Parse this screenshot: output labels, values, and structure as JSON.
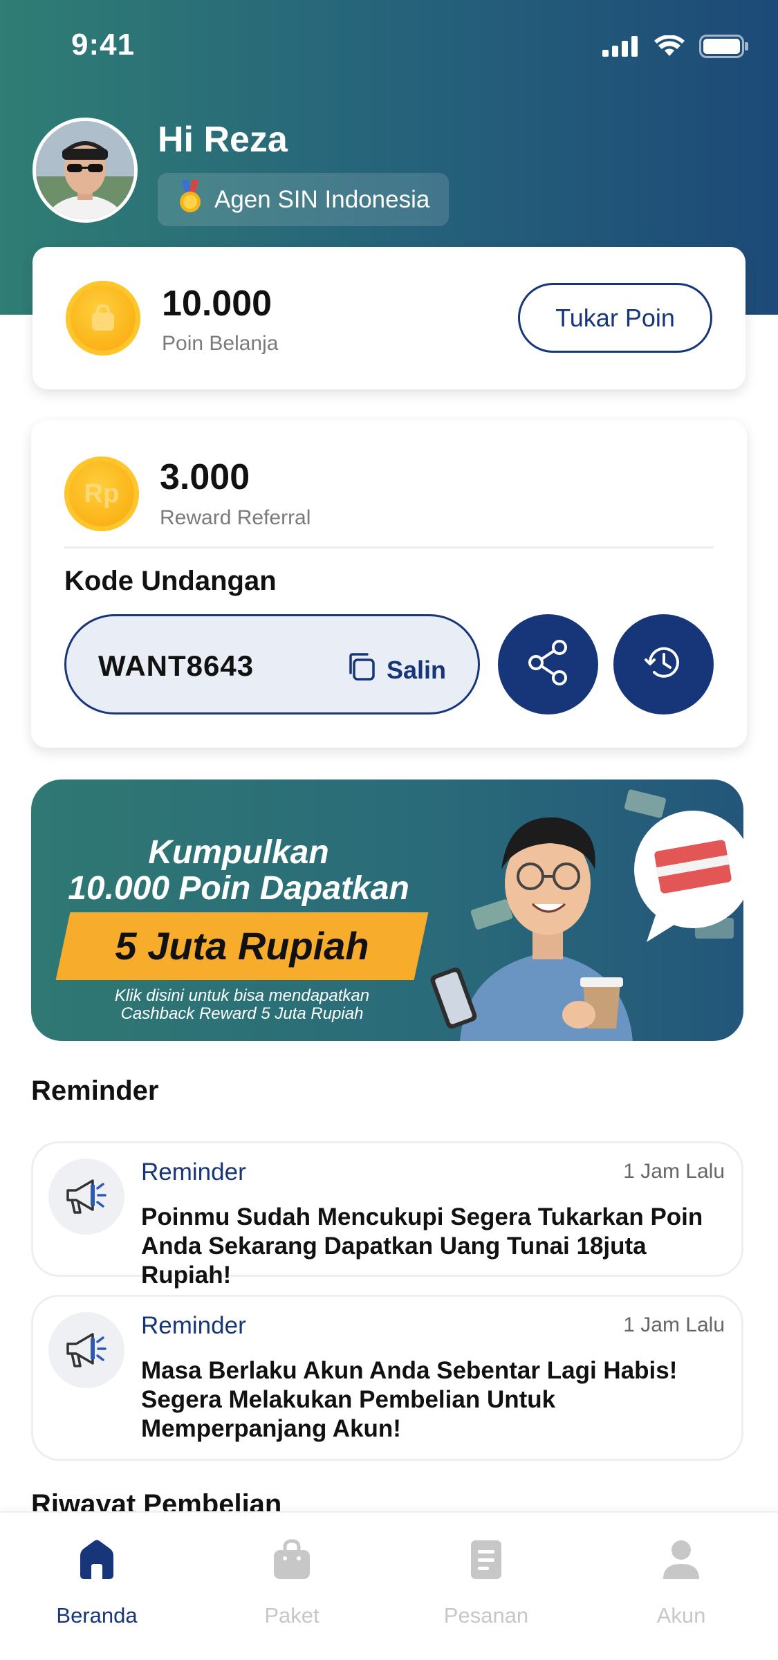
{
  "status_bar": {
    "time": "9:41"
  },
  "header": {
    "greeting": "Hi Reza",
    "badge_label": "Agen SIN Indonesia"
  },
  "points_card": {
    "value": "10.000",
    "label": "Poin Belanja",
    "button_label": "Tukar Poin"
  },
  "referral_card": {
    "value": "3.000",
    "label": "Reward Referral",
    "coin_text": "Rp",
    "invite_title": "Kode Undangan",
    "invite_code": "WANT8643",
    "copy_label": "Salin"
  },
  "promo_banner": {
    "line1": "Kumpulkan",
    "line2": "10.000 Poin Dapatkan",
    "highlight": "5 Juta Rupiah",
    "caption_line1": "Klik disini untuk bisa mendapatkan",
    "caption_line2": "Cashback Reward 5 Juta Rupiah"
  },
  "reminder_section": {
    "title": "Reminder",
    "items": [
      {
        "category": "Reminder",
        "time": "1 Jam Lalu",
        "message_lines": [
          "Poinmu Sudah Mencukupi Segera Tukarkan Poin",
          "Anda Sekarang Dapatkan Uang Tunai 18juta Rupiah!"
        ]
      },
      {
        "category": "Reminder",
        "time": "1 Jam Lalu",
        "message_lines": [
          "Masa Berlaku Akun Anda Sebentar Lagi Habis!",
          "Segera Melakukan Pembelian Untuk",
          "Memperpanjang Akun!"
        ]
      }
    ]
  },
  "history_section": {
    "title": "Riwayat Pembelian"
  },
  "tab_bar": {
    "active_color": "#17367a",
    "inactive_color": "#c7c7c7",
    "items": [
      {
        "label": "Beranda",
        "icon": "home-icon",
        "active": true
      },
      {
        "label": "Paket",
        "icon": "shopping-bag-icon",
        "active": false
      },
      {
        "label": "Pesanan",
        "icon": "document-icon",
        "active": false
      },
      {
        "label": "Akun",
        "icon": "user-icon",
        "active": false
      }
    ]
  },
  "colors": {
    "primary": "#17367a",
    "coin": "#fbb419",
    "banner_accent": "#f8ac2b"
  }
}
